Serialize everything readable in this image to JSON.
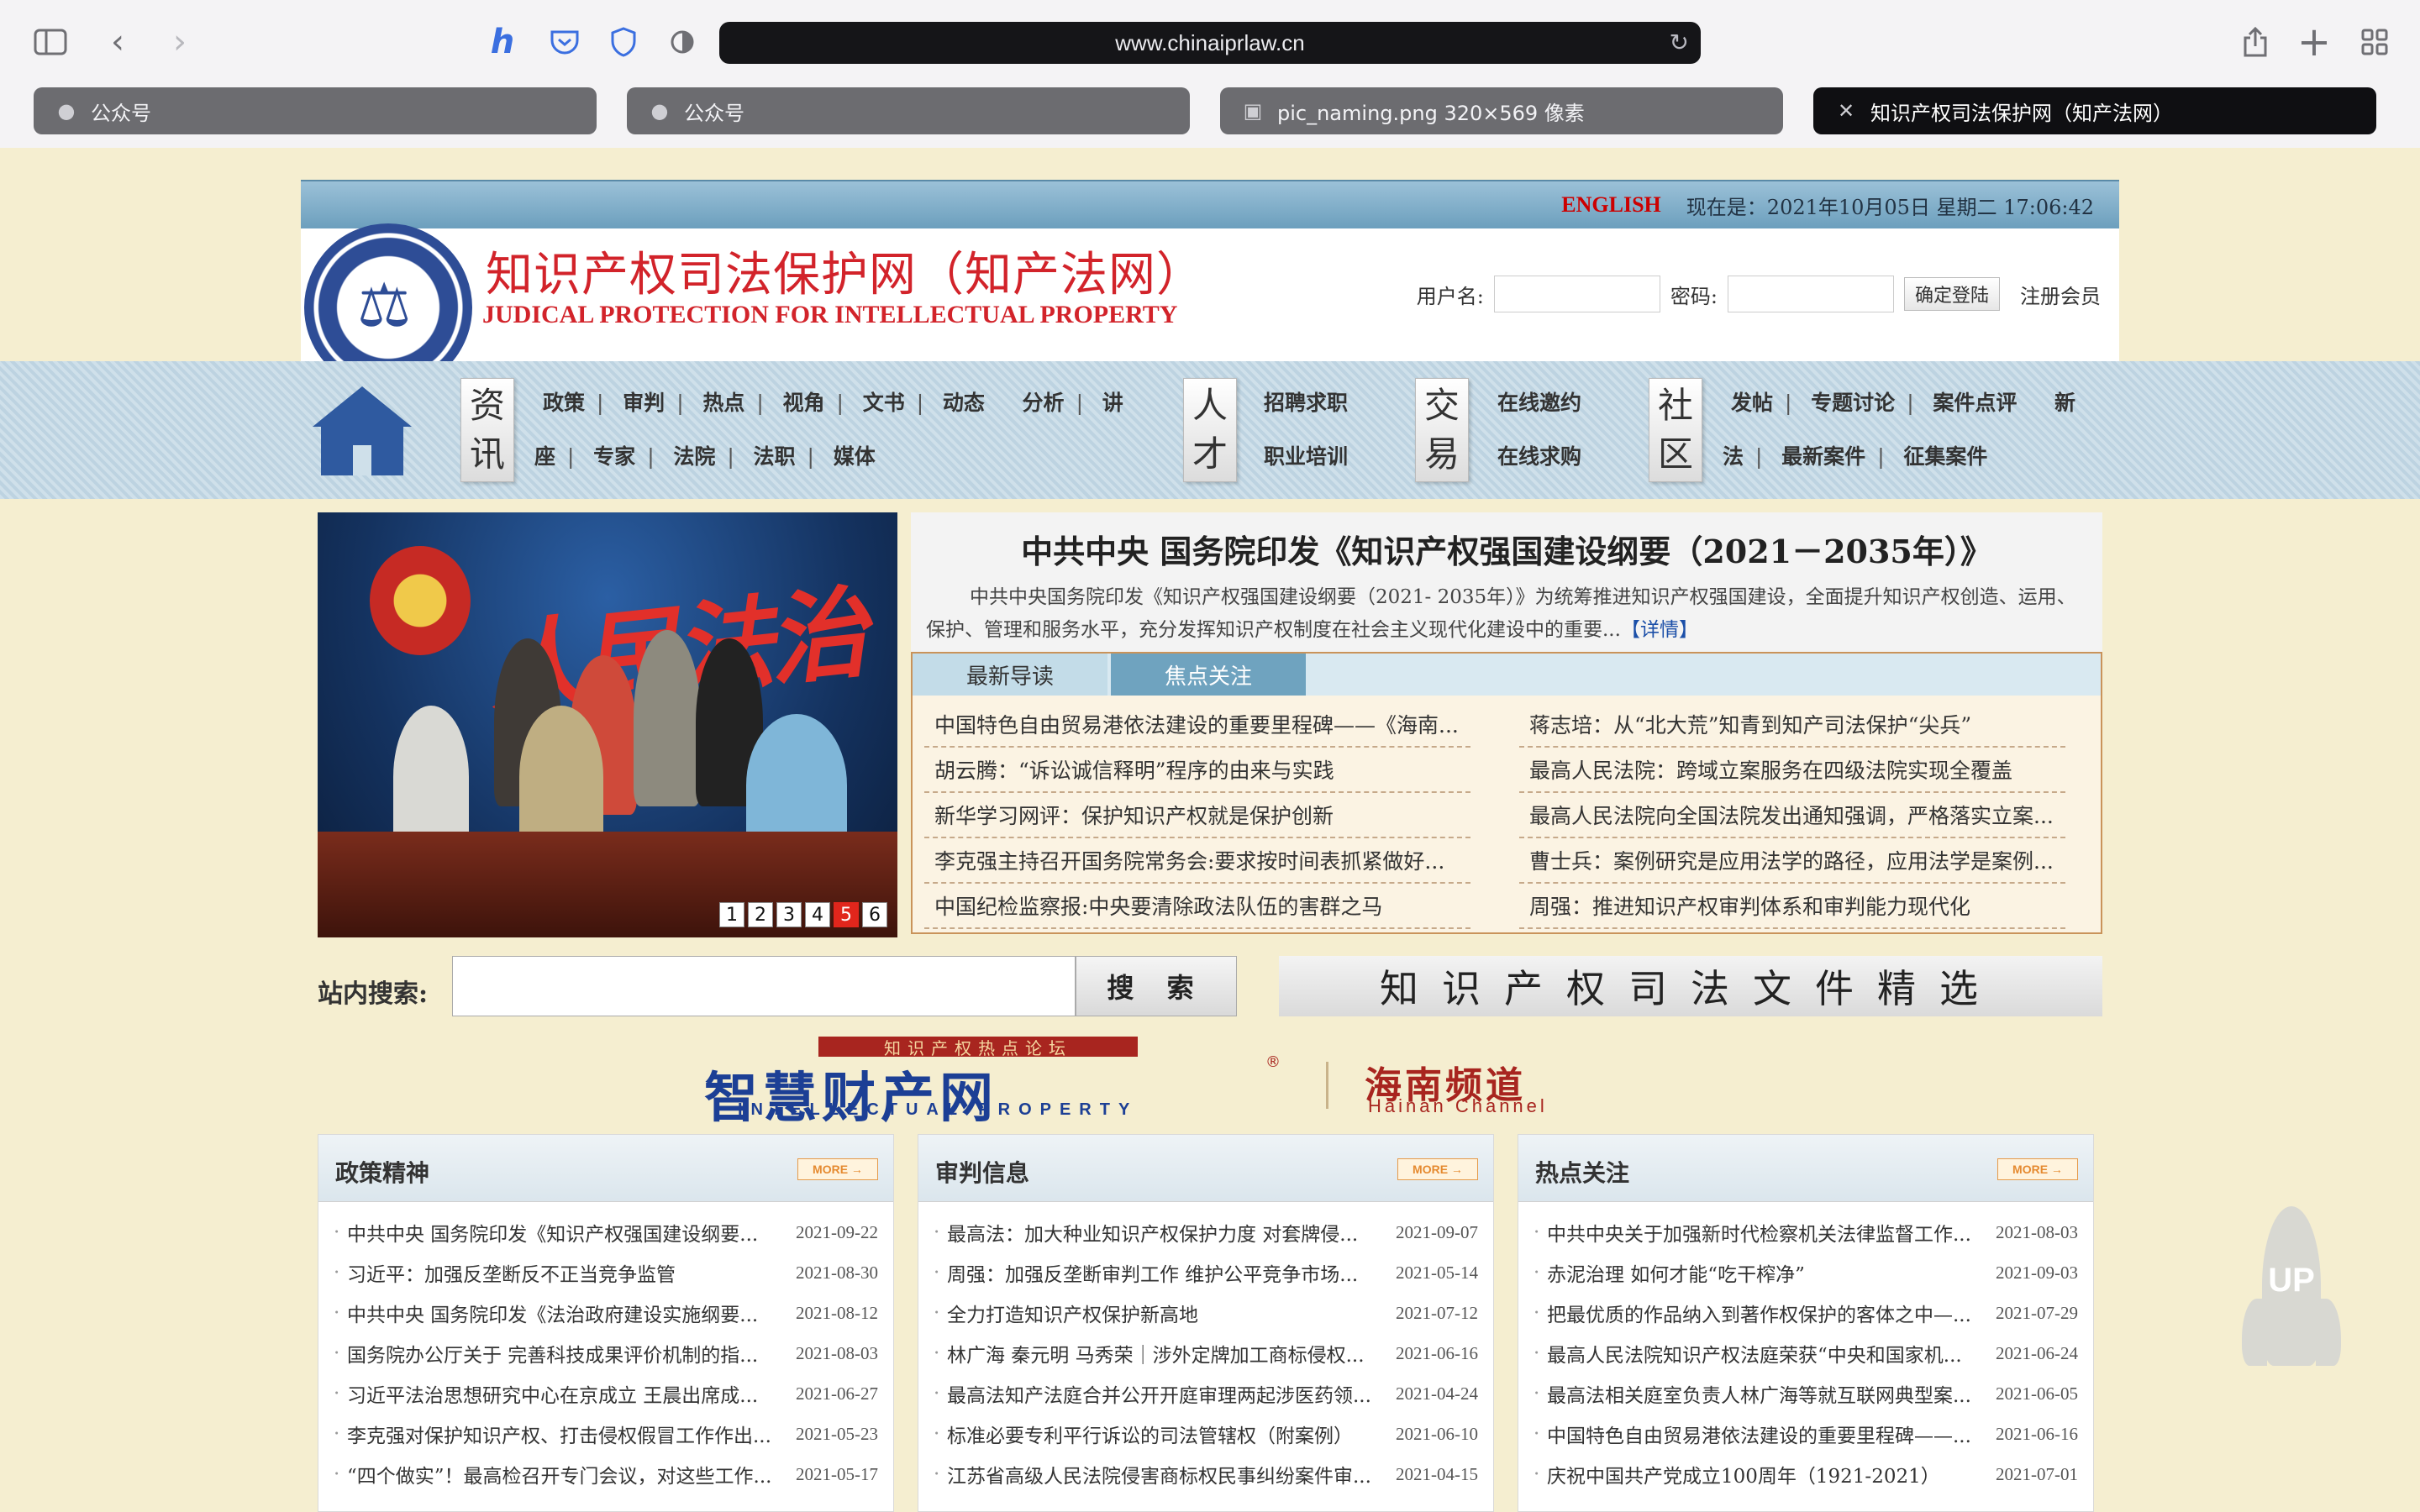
{
  "browser": {
    "url": "www.chinaiprlaw.cn",
    "tabs": [
      {
        "label": "公众号",
        "icon": "wechat-icon"
      },
      {
        "label": "公众号",
        "icon": "wechat-icon"
      },
      {
        "label": "pic_naming.png 320×569 像素",
        "icon": "image-icon"
      },
      {
        "label": "知识产权司法保护网（知产法网）",
        "icon": "close-icon"
      }
    ]
  },
  "site": {
    "english_link": "ENGLISH",
    "datetime": "现在是：2021年10月05日 星期二 17:06:42",
    "title_cn": "知识产权司法保护网（知产法网）",
    "title_en": "JUDICAL PROTECTION FOR INTELLECTUAL PROPERTY",
    "login": {
      "username_label": "用户名:",
      "password_label": "密码:",
      "submit_label": "确定登陆",
      "register_label": "注册会员"
    }
  },
  "nav": {
    "zixun": {
      "tag_top": "资",
      "tag_bottom": "讯",
      "row1": [
        "政策",
        "审判",
        "热点",
        "视角",
        "文书",
        "动态",
        "分析",
        "讲"
      ],
      "row2": [
        "座",
        "专家",
        "法院",
        "法职",
        "媒体"
      ]
    },
    "rencai": {
      "tag_top": "人",
      "tag_bottom": "才",
      "row1": [
        "招聘求职"
      ],
      "row2": [
        "职业培训"
      ]
    },
    "jiaoyi": {
      "tag_top": "交",
      "tag_bottom": "易",
      "row1": [
        "在线邀约"
      ],
      "row2": [
        "在线求购"
      ]
    },
    "shequ": {
      "tag_top": "社",
      "tag_bottom": "区",
      "row1": [
        "发帖",
        "专题讨论",
        "案件点评",
        "新"
      ],
      "row2": [
        "法",
        "最新案件",
        "征集案件"
      ]
    }
  },
  "slider": {
    "banner_text": "人民法治",
    "pages": [
      "1",
      "2",
      "3",
      "4",
      "5",
      "6"
    ],
    "active_page": 5
  },
  "headline": {
    "title": "中共中央 国务院印发《知识产权强国建设纲要（2021－2035年）》",
    "desc": "中共中央国务院印发《知识产权强国建设纲要（2021- 2035年）》为统筹推进知识产权强国建设，全面提升知识产权创造、运用、保护、管理和服务水平，充分发挥知识产权制度在社会主义现代化建设中的重要...",
    "more": "【详情】"
  },
  "news_tabs": [
    "最新导读",
    "焦点关注"
  ],
  "news_left": [
    "中国特色自由贸易港依法建设的重要里程碑——《海南...",
    "胡云腾：“诉讼诚信释明”程序的由来与实践",
    "新华学习网评：保护知识产权就是保护创新",
    "李克强主持召开国务院常务会:要求按时间表抓紧做好...",
    "中国纪检监察报:中央要清除政法队伍的害群之马"
  ],
  "news_right": [
    "蒋志培：从“北大荒”知青到知产司法保护“尖兵”",
    "最高人民法院：跨域立案服务在四级法院实现全覆盖",
    "最高人民法院向全国法院发出通知强调，严格落实立案...",
    "曹士兵：案例研究是应用法学的路径，应用法学是案例...",
    "周强：推进知识产权审判体系和审判能力现代化"
  ],
  "search": {
    "label": "站内搜索:",
    "button": "搜 索",
    "files_banner": "知识产权司法文件精选"
  },
  "banner2": {
    "pill": "知识产权热点论坛",
    "big": "智慧财产网",
    "en": "INTELLECTUAL PROPERTY",
    "reg": "®",
    "hn": "海南频道",
    "hn_en": "Hainan Channel"
  },
  "columns": [
    {
      "title": "政策精神",
      "more": "MORE →",
      "items": [
        {
          "t": "中共中央 国务院印发《知识产权强国建设纲要...",
          "d": "2021-09-22"
        },
        {
          "t": "习近平：加强反垄断反不正当竞争监管",
          "d": "2021-08-30"
        },
        {
          "t": "中共中央 国务院印发《法治政府建设实施纲要...",
          "d": "2021-08-12"
        },
        {
          "t": "国务院办公厅关于 完善科技成果评价机制的指...",
          "d": "2021-08-03"
        },
        {
          "t": "习近平法治思想研究中心在京成立 王晨出席成...",
          "d": "2021-06-27"
        },
        {
          "t": "李克强对保护知识产权、打击侵权假冒工作作出...",
          "d": "2021-05-23"
        },
        {
          "t": "“四个做实”！最高检召开专门会议，对这些工作...",
          "d": "2021-05-17"
        }
      ]
    },
    {
      "title": "审判信息",
      "more": "MORE →",
      "items": [
        {
          "t": "最高法：加大种业知识产权保护力度 对套牌侵...",
          "d": "2021-09-07"
        },
        {
          "t": "周强：加强反垄断审判工作 维护公平竞争市场...",
          "d": "2021-05-14"
        },
        {
          "t": "全力打造知识产权保护新高地",
          "d": "2021-07-12"
        },
        {
          "t": "林广海 秦元明 马秀荣｜涉外定牌加工商标侵权...",
          "d": "2021-06-16"
        },
        {
          "t": "最高法知产法庭合并公开开庭审理两起涉医药领...",
          "d": "2021-04-24"
        },
        {
          "t": "标准必要专利平行诉讼的司法管辖权（附案例）",
          "d": "2021-06-10"
        },
        {
          "t": "江苏省高级人民法院侵害商标权民事纠纷案件审...",
          "d": "2021-04-15"
        }
      ]
    },
    {
      "title": "热点关注",
      "more": "MORE →",
      "items": [
        {
          "t": "中共中央关于加强新时代检察机关法律监督工作...",
          "d": "2021-08-03"
        },
        {
          "t": "赤泥治理 如何才能“吃干榨净”",
          "d": "2021-09-03"
        },
        {
          "t": "把最优质的作品纳入到著作权保护的客体之中—...",
          "d": "2021-07-29"
        },
        {
          "t": "最高人民法院知识产权法庭荣获“中央和国家机...",
          "d": "2021-06-24"
        },
        {
          "t": "最高法相关庭室负责人林广海等就互联网典型案...",
          "d": "2021-06-05"
        },
        {
          "t": "中国特色自由贸易港依法建设的重要里程碑——...",
          "d": "2021-06-16"
        },
        {
          "t": "庆祝中国共产党成立100周年（1921-2021）",
          "d": "2021-07-01"
        }
      ]
    }
  ],
  "up_button": "UP"
}
